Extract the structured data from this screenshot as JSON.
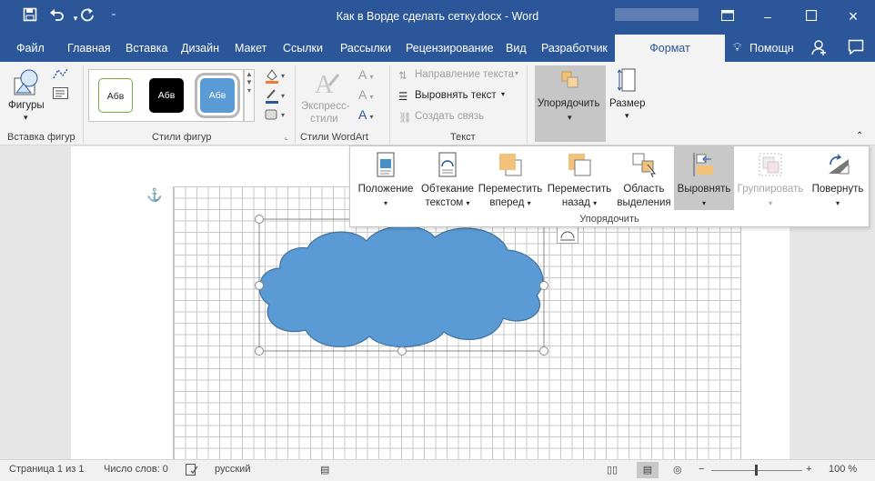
{
  "titlebar": {
    "title": "Как в Ворде сделать сетку.docx - Word",
    "qat_icons": [
      "save-icon",
      "undo-icon",
      "redo-icon",
      "customize-qat-icon"
    ],
    "window_buttons": [
      "ribbon-display-icon",
      "minimize-icon",
      "maximize-icon",
      "close-icon"
    ]
  },
  "tabs": [
    "Файл",
    "Главная",
    "Вставка",
    "Дизайн",
    "Макет",
    "Ссылки",
    "Рассылки",
    "Рецензирование",
    "Вид",
    "Разработчик"
  ],
  "active_tab": "Формат",
  "tell_me": "Помощн",
  "ribbon": {
    "insert_shapes": {
      "button": "Фигуры",
      "group_label": "Вставка фигур"
    },
    "shape_styles": {
      "samples": [
        "Абв",
        "Абв",
        "Абв"
      ],
      "group_label": "Стили фигур"
    },
    "wordart": {
      "button": "Экспресс-стили",
      "button_line1": "Экспресс-",
      "button_line2": "стили",
      "group_label": "Стили WordArt"
    },
    "text": {
      "direction": "Направление текста",
      "align": "Выровнять текст",
      "link": "Создать связь",
      "group_label": "Текст"
    },
    "arrange_button": "Упорядочить",
    "size_button": "Размер"
  },
  "arrange_dropdown": {
    "items": [
      {
        "line1": "Положение",
        "line2": "",
        "icon": "position-icon"
      },
      {
        "line1": "Обтекание",
        "line2": "текстом",
        "icon": "wrap-text-icon"
      },
      {
        "line1": "Переместить",
        "line2": "вперед",
        "icon": "bring-forward-icon"
      },
      {
        "line1": "Переместить",
        "line2": "назад",
        "icon": "send-backward-icon"
      },
      {
        "line1": "Область",
        "line2": "выделения",
        "icon": "selection-pane-icon"
      },
      {
        "line1": "Выровнять",
        "line2": "",
        "icon": "align-icon"
      },
      {
        "line1": "Группировать",
        "line2": "",
        "icon": "group-icon"
      },
      {
        "line1": "Повернуть",
        "line2": "",
        "icon": "rotate-icon"
      }
    ],
    "group_label": "Упорядочить"
  },
  "status": {
    "page": "Страница 1 из 1",
    "words": "Число слов: 0",
    "language": "русский",
    "zoom": "100 %"
  },
  "colors": {
    "accent": "#2b579a",
    "shape_fill": "#5b9bd5",
    "shape_stroke": "#41719c"
  }
}
